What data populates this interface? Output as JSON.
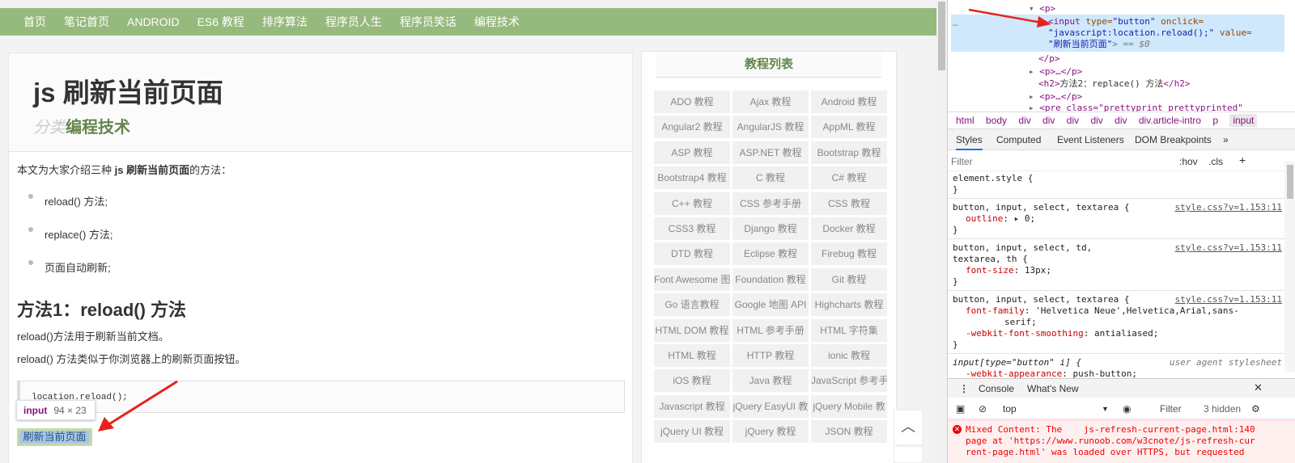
{
  "nav": [
    "首页",
    "笔记首页",
    "ANDROID",
    "ES6 教程",
    "排序算法",
    "程序员人生",
    "程序员笑话",
    "编程技术"
  ],
  "article": {
    "title": "js 刷新当前页面",
    "category_label": "分类",
    "category_value": "编程技术",
    "intro_before": "本文为大家介绍三种 ",
    "intro_bold": "js 刷新当前页面",
    "intro_after": "的方法：",
    "list": [
      "reload() 方法;",
      "replace() 方法;",
      "页面自动刷新;"
    ],
    "h2": "方法1：reload() 方法",
    "p1": "reload()方法用于刷新当前文档。",
    "p2": "reload() 方法类似于你浏览器上的刷新页面按钮。",
    "code": "location.reload();",
    "button_label": "刷新当前页面",
    "tooltip_tag": "input",
    "tooltip_dims": "94 × 23"
  },
  "sidebar": {
    "title": "教程列表",
    "items": [
      "ADO 教程",
      "Ajax 教程",
      "Android 教程",
      "Angular2 教程",
      "AngularJS 教程",
      "AppML 教程",
      "ASP 教程",
      "ASP.NET 教程",
      "Bootstrap 教程",
      "Bootstrap4 教程",
      "C 教程",
      "C# 教程",
      "C++ 教程",
      "CSS 参考手册",
      "CSS 教程",
      "CSS3 教程",
      "Django 教程",
      "Docker 教程",
      "DTD 教程",
      "Eclipse 教程",
      "Firebug 教程",
      "Font Awesome 图",
      "Foundation 教程",
      "Git 教程",
      "Go 语言教程",
      "Google 地图 API",
      "Highcharts 教程",
      "HTML DOM 教程",
      "HTML 参考手册",
      "HTML 字符集",
      "HTML 教程",
      "HTTP 教程",
      "ionic 教程",
      "iOS 教程",
      "Java 教程",
      "JavaScript 参考手",
      "Javascript 教程",
      "jQuery EasyUI 教",
      "jQuery Mobile 教",
      "jQuery UI 教程",
      "jQuery 教程",
      "JSON 教程"
    ],
    "totop": "︿"
  },
  "devtools": {
    "elements": {
      "p_open": "<p>",
      "input_tag": "<input",
      "attr_type": " type=",
      "val_type": "\"button\"",
      "attr_onclick": " onclick=",
      "val_onclick": "\"javascript:location.reload();\"",
      "attr_value": " value=",
      "val_value": "\"刷新当前页面\"",
      "close_eq": "> == $0",
      "p_close": "</p>",
      "p_collapsed": "<p>…</p>",
      "h2_open": "<h2>",
      "h2_text": "方法2：replace() 方法",
      "h2_close": "</h2>",
      "p_collapsed2": "<p>…</p>",
      "pre_line": "<pre class=\"prettyprint prettyprinted\"",
      "dots": "…"
    },
    "breadcrumbs": [
      "html",
      "body",
      "div",
      "div",
      "div",
      "div",
      "div",
      "div.article-intro",
      "p",
      "input"
    ],
    "style_tabs": [
      "Styles",
      "Computed",
      "Event Listeners",
      "DOM Breakpoints",
      "»"
    ],
    "filter_placeholder": "Filter",
    "hov": ":hov",
    "cls": ".cls",
    "plus": "+",
    "rules": [
      {
        "selector": "element.style {",
        "source": "",
        "props": [],
        "close": "}"
      },
      {
        "selector": "button, input, select, textarea {",
        "source": "style.css?v=1.153:11",
        "props": [
          [
            "outline",
            "▸ 0;"
          ]
        ],
        "close": "}"
      },
      {
        "selector": "button, input, select, td,",
        "selector2": "textarea, th {",
        "source": "style.css?v=1.153:11",
        "props": [
          [
            "font-size",
            "13px;"
          ]
        ],
        "close": "}"
      },
      {
        "selector": "button, input, select, textarea {",
        "source": "style.css?v=1.153:11",
        "props": [
          [
            "font-family",
            "'Helvetica Neue',Helvetica,Arial,sans-"
          ],
          [
            "",
            "serif;"
          ],
          [
            "-webkit-font-smoothing",
            "antialiased;"
          ]
        ],
        "close": "}"
      },
      {
        "selector": "input[type=\"button\" i] {",
        "source": "user agent stylesheet",
        "props": [
          [
            "-webkit-appearance",
            "push-button;"
          ]
        ],
        "close": ""
      }
    ],
    "console_tabs": [
      "Console",
      "What's New"
    ],
    "context": "top",
    "console_filter": "Filter",
    "hidden": "3 hidden",
    "error": "Mixed Content: The    js-refresh-current-page.html:140\npage at 'https://www.runoob.com/w3cnote/js-refresh-cur\nrent-page.html' was loaded over HTTPS, but requested"
  }
}
